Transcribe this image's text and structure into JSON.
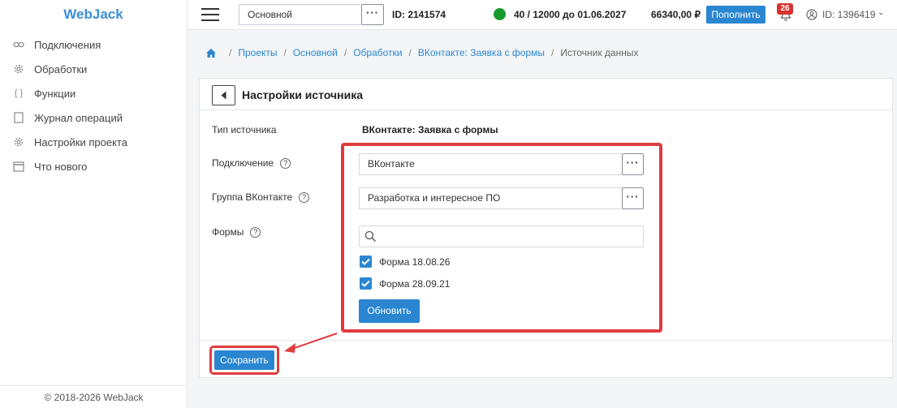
{
  "sidebar": {
    "logo": "WebJack",
    "items": [
      {
        "label": "Подключения",
        "icon": "link-icon"
      },
      {
        "label": "Обработки",
        "icon": "gear-icon"
      },
      {
        "label": "Функции",
        "icon": "braces-icon"
      },
      {
        "label": "Журнал операций",
        "icon": "journal-icon"
      },
      {
        "label": "Настройки проекта",
        "icon": "settings-icon"
      },
      {
        "label": "Что нового",
        "icon": "calendar-icon"
      }
    ],
    "footer": "© 2018-2026 WebJack"
  },
  "topbar": {
    "project": "Основной",
    "project_id": "ID: 2141574",
    "quota": "40 / 12000 до 01.06.2027",
    "balance": "66340,00 ₽",
    "topup_label": "Пополнить",
    "notifications": "26",
    "user_id": "ID: 1396419"
  },
  "breadcrumb": {
    "items": [
      "Проекты",
      "Основной",
      "Обработки",
      "ВКонтакте: Заявка с формы"
    ],
    "current": "Источник данных"
  },
  "card": {
    "title": "Настройки источника",
    "source_type_label": "Тип источника",
    "source_type_value": "ВКонтакте: Заявка с формы",
    "connection_label": "Подключение",
    "connection_value": "ВКонтакте",
    "group_label": "Группа ВКонтакте",
    "group_value": "Разработка и интересное ПО",
    "forms_label": "Формы",
    "search_placeholder": "",
    "forms": [
      {
        "label": "Форма 18.08.26",
        "checked": true
      },
      {
        "label": "Форма 28.09.21",
        "checked": true
      }
    ],
    "refresh_label": "Обновить",
    "save_label": "Сохранить",
    "help_glyph": "?"
  },
  "colors": {
    "accent": "#2a86d1",
    "highlight": "#e03c3f",
    "status": "#169a2d",
    "badge": "#d9322f"
  }
}
